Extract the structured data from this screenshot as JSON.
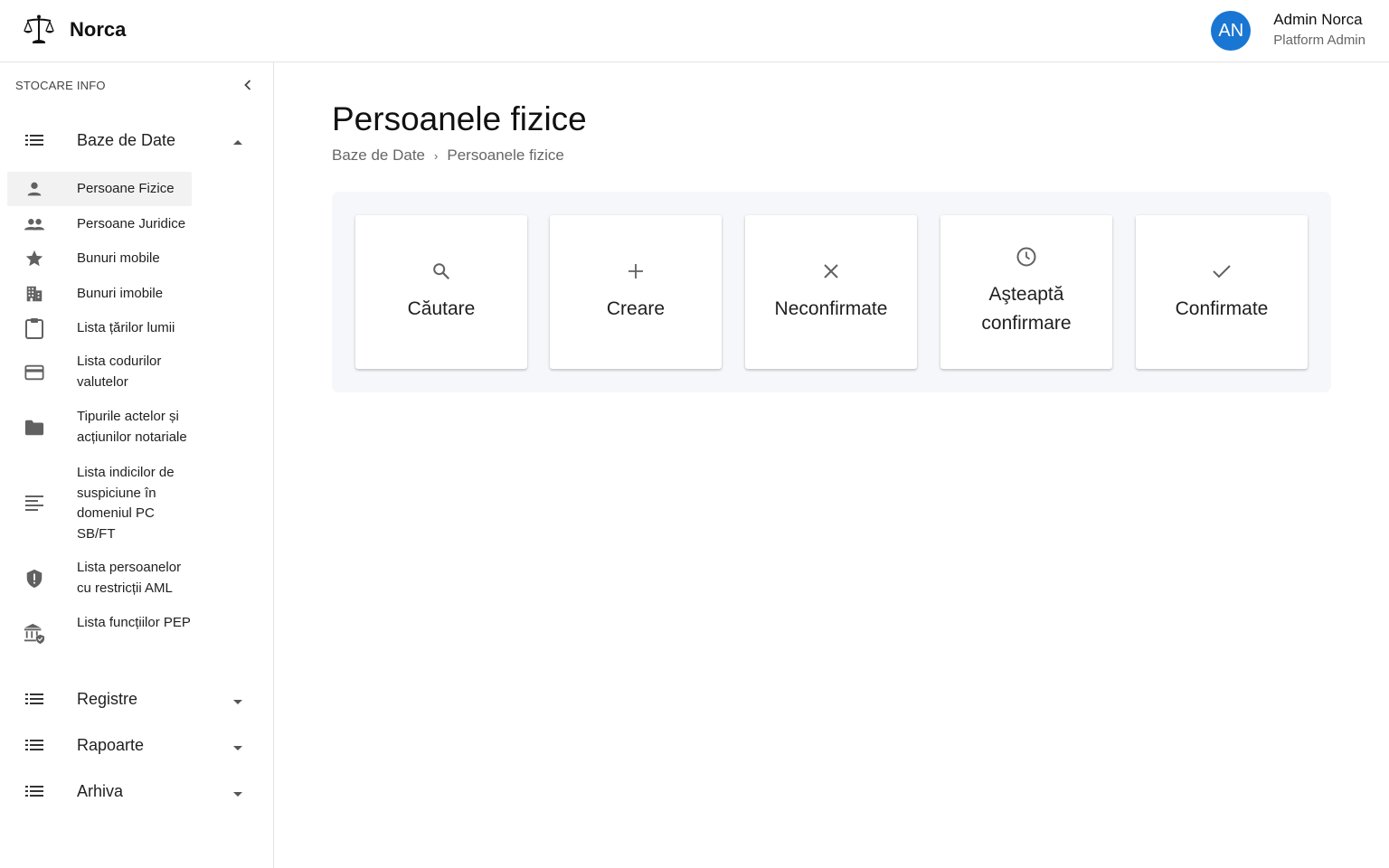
{
  "app": {
    "name": "Norca"
  },
  "user": {
    "initials": "AN",
    "name": "Admin Norca",
    "role": "Platform Admin",
    "avatar_color": "#1976d2"
  },
  "sidebar": {
    "header": "STOCARE INFO",
    "sections": [
      {
        "label": "Baze de Date",
        "expanded": true
      },
      {
        "label": "Registre",
        "expanded": false
      },
      {
        "label": "Rapoarte",
        "expanded": false
      },
      {
        "label": "Arhiva",
        "expanded": false
      }
    ],
    "items": [
      {
        "label": "Persoane Fizice",
        "icon": "person-icon",
        "active": true
      },
      {
        "label": "Persoane Juridice",
        "icon": "people-icon"
      },
      {
        "label": "Bunuri mobile",
        "icon": "star-icon"
      },
      {
        "label": "Bunuri imobile",
        "icon": "building-icon"
      },
      {
        "label": "Lista țărilor lumii",
        "icon": "clipboard-icon"
      },
      {
        "label": "Lista codurilor valutelor",
        "icon": "credit-card-icon"
      },
      {
        "label": "Tipurile actelor și acțiunilor notariale",
        "icon": "folder-icon"
      },
      {
        "label": "Lista indicilor de suspiciune în domeniul PC SB/FT",
        "icon": "notes-icon"
      },
      {
        "label": "Lista persoanelor cu restricții AML",
        "icon": "shield-alert-icon"
      },
      {
        "label": "Lista funcțiilor PEP",
        "icon": "bank-shield-icon"
      }
    ]
  },
  "main": {
    "title": "Persoanele fizice",
    "breadcrumb": [
      "Baze de Date",
      "Persoanele fizice"
    ],
    "breadcrumb_separator": "›",
    "cards": [
      {
        "label": "Căutare",
        "icon": "search-icon"
      },
      {
        "label": "Creare",
        "icon": "plus-icon"
      },
      {
        "label": "Neconfirmate",
        "icon": "close-icon"
      },
      {
        "label": "Aşteaptă confirmare",
        "icon": "clock-icon"
      },
      {
        "label": "Confirmate",
        "icon": "check-icon"
      }
    ]
  }
}
